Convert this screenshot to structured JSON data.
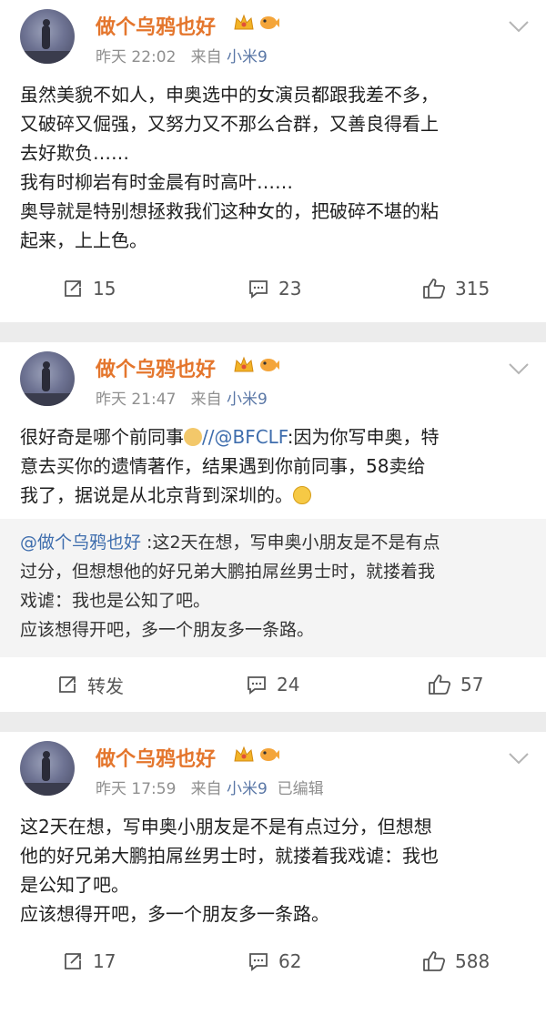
{
  "posts": [
    {
      "author": "做个乌鸦也好",
      "time": "昨天 22:02",
      "from_label": "来自",
      "source": "小米9",
      "edited": "",
      "lines": [
        "虽然美貌不如人，申奥选中的女演员都跟我差不多，",
        "又破碎又倔强，又努力又不那么合群，又善良得看上",
        "去好欺负……",
        "我有时柳岩有时金晨有时高叶……",
        "奥导就是特别想拯救我们这种女的，把破碎不堪的粘",
        "起来，上上色。"
      ],
      "reposts": "15",
      "comments": "23",
      "likes": "315"
    },
    {
      "author": "做个乌鸦也好",
      "time": "昨天 21:47",
      "from_label": "来自",
      "source": "小米9",
      "text_before": "很好奇是哪个前同事",
      "mention": "//@BFCLF",
      "text_after_1": ":因为你写申奥，特",
      "line2": "意去买你的遗情著作，结果遇到你前同事，58卖给",
      "line3": "我了，据说是从北京背到深圳的。",
      "quote_mention": "@做个乌鸦也好",
      "quote_line1": " :这2天在想，写申奥小朋友是不是有点",
      "quote_lines": [
        "过分，但想想他的好兄弟大鹏拍屌丝男士时，就搂着我",
        "戏谑：我也是公知了吧。",
        "应该想得开吧，多一个朋友多一条路。"
      ],
      "reposts": "转发",
      "comments": "24",
      "likes": "57"
    },
    {
      "author": "做个乌鸦也好",
      "time": "昨天 17:59",
      "from_label": "来自",
      "source": "小米9",
      "edited": "已编辑",
      "lines": [
        "这2天在想，写申奥小朋友是不是有点过分，但想想",
        "他的好兄弟大鹏拍屌丝男士时，就搂着我戏谑：我也",
        "是公知了吧。",
        "应该想得开吧，多一个朋友多一条路。"
      ],
      "reposts": "17",
      "comments": "62",
      "likes": "588"
    }
  ],
  "colors": {
    "author": "#e4762d",
    "mention": "#3e6dad",
    "meta": "#8f8f8f"
  },
  "icons": [
    "repost-icon",
    "comment-icon",
    "like-icon",
    "crown-badge-icon",
    "fish-badge-icon",
    "chevron-down-icon",
    "dog-emoji-icon",
    "grin-emoji-icon"
  ]
}
